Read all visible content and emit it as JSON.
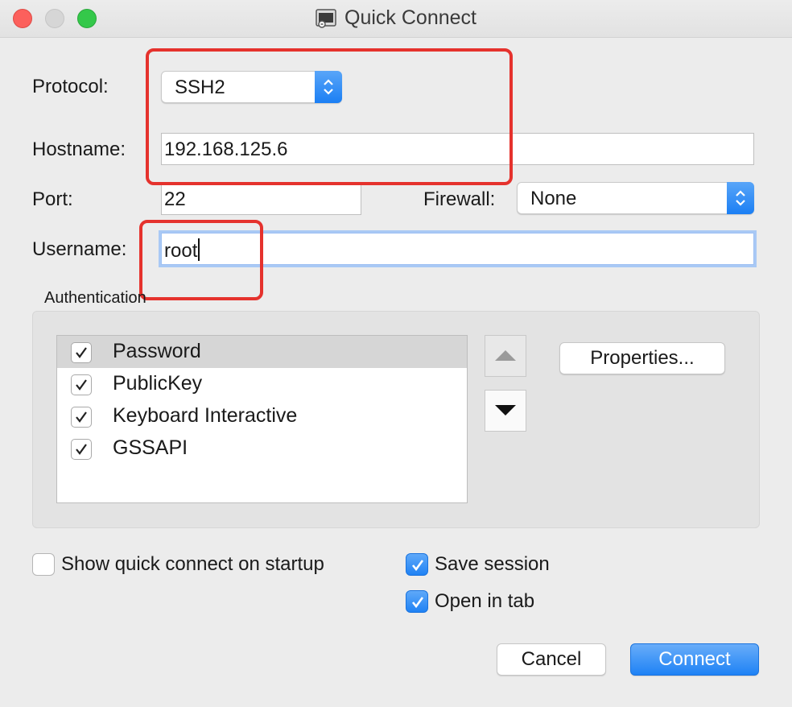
{
  "window": {
    "title": "Quick Connect"
  },
  "form": {
    "protocol_label": "Protocol:",
    "protocol_value": "SSH2",
    "hostname_label": "Hostname:",
    "hostname_value": "192.168.125.6",
    "port_label": "Port:",
    "port_value": "22",
    "firewall_label": "Firewall:",
    "firewall_value": "None",
    "username_label": "Username:",
    "username_value": "root"
  },
  "auth": {
    "title": "Authentication",
    "methods": [
      {
        "label": "Password",
        "checked": true,
        "selected": true
      },
      {
        "label": "PublicKey",
        "checked": true,
        "selected": false
      },
      {
        "label": "Keyboard Interactive",
        "checked": true,
        "selected": false
      },
      {
        "label": "GSSAPI",
        "checked": true,
        "selected": false
      }
    ],
    "properties_label": "Properties..."
  },
  "options": {
    "show_on_startup": {
      "label": "Show quick connect on startup",
      "checked": false
    },
    "save_session": {
      "label": "Save session",
      "checked": true
    },
    "open_in_tab": {
      "label": "Open in tab",
      "checked": true
    }
  },
  "buttons": {
    "cancel": "Cancel",
    "connect": "Connect"
  },
  "colors": {
    "accent": "#1e82f5",
    "annotation": "#e5322d"
  }
}
